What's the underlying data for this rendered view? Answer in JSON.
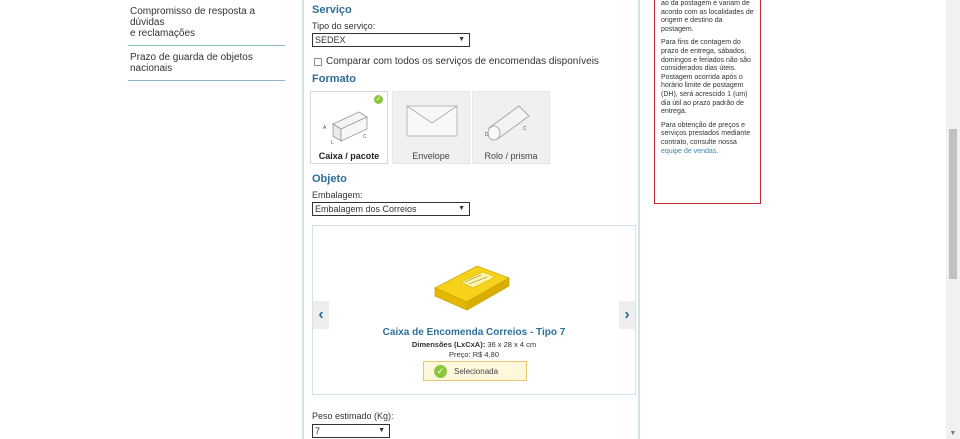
{
  "nav": {
    "items": [
      {
        "line1": "Compromisso de resposta a dúvidas",
        "line2": "e reclamações"
      },
      {
        "line1": "Prazo de guarda de objetos",
        "line2": "nacionais"
      }
    ]
  },
  "servico": {
    "title": "Serviço",
    "tipo_label": "Tipo do serviço:",
    "tipo_value": "SEDEX",
    "comparar_label": "Comparar com todos os serviços de encomendas disponíveis"
  },
  "formato": {
    "title": "Formato",
    "options": [
      {
        "label": "Caixa / pacote",
        "selected": true
      },
      {
        "label": "Envelope",
        "selected": false
      },
      {
        "label": "Rolo / prisma",
        "selected": false
      }
    ],
    "box_letters": {
      "a": "A",
      "l": "L",
      "c": "C"
    },
    "roll_letters": {
      "d": "D",
      "c": "C"
    }
  },
  "objeto": {
    "title": "Objeto",
    "embalagem_label": "Embalagem:",
    "embalagem_value": "Embalagem dos Correios",
    "carousel": {
      "prev": "‹",
      "next": "›",
      "product_title": "Caixa de Encomenda Correios - Tipo 7",
      "dim_label": "Dimensões (LxCxA):",
      "dim_value": "36 x 28 x 4 cm",
      "price_label": "Preço:",
      "price_value": "R$ 4,80",
      "selected_label": "Selecionada"
    }
  },
  "peso": {
    "label": "Peso estimado (Kg):",
    "value": "7"
  },
  "info": {
    "p1": "ao da postagem e variam de acordo com as localidades de origem e destino da postagem.",
    "p2": "Para fins de contagem do prazo de entrega, sábados, domingos e feriados não são considerados dias úteis. Postagem ocorrida após o horário limite de postagem (DH), será acrescido 1 (um) dia útil ao prazo padrão de entrega.",
    "p3_text": "Para obtenção de preços e serviços prestados mediante contrato, consulte nossa",
    "p3_link": "equipe de vendas",
    "p3_end": "."
  },
  "colors": {
    "accent": "#2e6f99",
    "check": "#8cc63f",
    "info_border": "#c4262e",
    "product": "#f2c500"
  },
  "icons": {
    "select_arrow": "▼",
    "check": "✓",
    "scroll_down": "▼"
  }
}
